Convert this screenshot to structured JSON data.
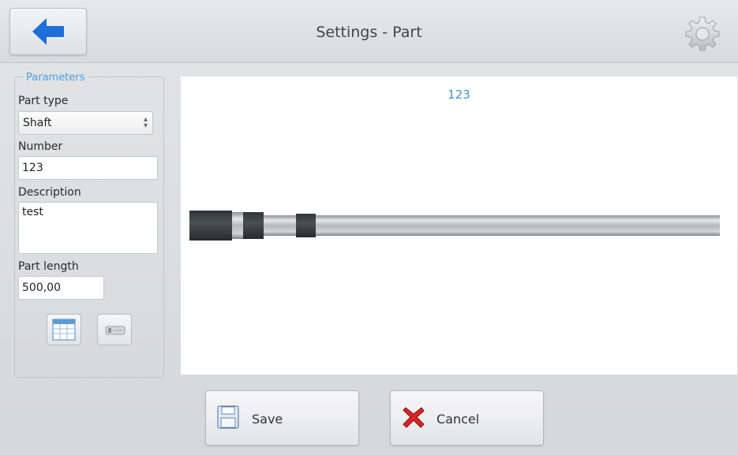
{
  "header": {
    "title": "Settings - Part",
    "back_icon": "arrow-left-icon",
    "settings_icon": "gear-icon",
    "accent": "#1e6fd9"
  },
  "parameters": {
    "legend": "Parameters",
    "part_type_label": "Part type",
    "part_type_value": "Shaft",
    "number_label": "Number",
    "number_value": "123",
    "description_label": "Description",
    "description_value": "test",
    "part_length_label": "Part length",
    "part_length_value": "500,00",
    "tools": [
      {
        "icon": "table-icon"
      },
      {
        "icon": "part-icon"
      }
    ]
  },
  "preview": {
    "part_label": "123",
    "label_color": "#3c93d3"
  },
  "actions": {
    "save_label": "Save",
    "save_icon": "floppy-disk-icon",
    "cancel_label": "Cancel",
    "cancel_icon": "red-x-icon"
  }
}
